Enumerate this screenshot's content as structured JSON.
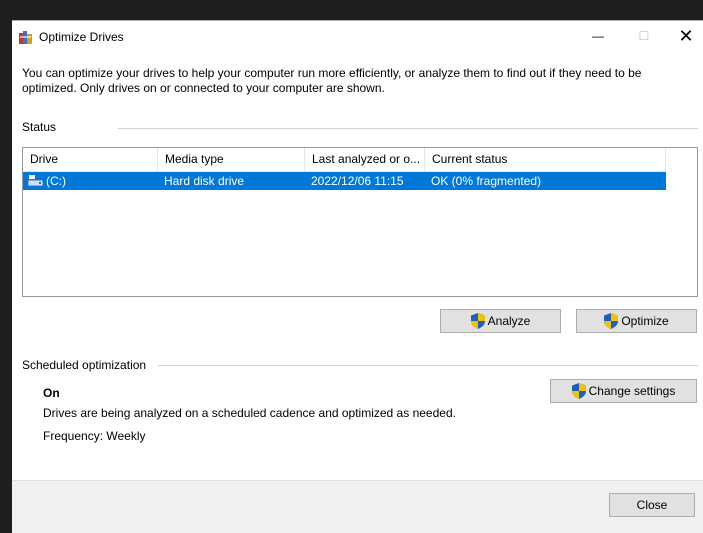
{
  "window": {
    "title": "Optimize Drives",
    "minimize_glyph": "—",
    "maximize_glyph": "☐",
    "close_glyph": "✕"
  },
  "intro_text": "You can optimize your drives to help your computer run more efficiently, or analyze them to find out if they need to be optimized. Only drives on or connected to your computer are shown.",
  "status": {
    "label": "Status",
    "columns": [
      "Drive",
      "Media type",
      "Last analyzed or o...",
      "Current status"
    ],
    "rows": [
      {
        "drive": "(C:)",
        "media_type": "Hard disk drive",
        "last_analyzed": "2022/12/06 11:15",
        "current_status": "OK (0% fragmented)",
        "selected": true
      }
    ],
    "analyze_label": "Analyze",
    "optimize_label": "Optimize"
  },
  "scheduled": {
    "label": "Scheduled optimization",
    "state": "On",
    "description": "Drives are being analyzed on a scheduled cadence and optimized as needed.",
    "frequency": "Frequency: Weekly",
    "change_settings_label": "Change settings"
  },
  "footer": {
    "close_label": "Close"
  },
  "colors": {
    "selection": "#0078d7",
    "button": "#e1e1e1",
    "shield_blue": "#1f5fbf",
    "shield_yellow": "#f2c200"
  },
  "icons": [
    "defrag-app-icon",
    "hard-drive-icon",
    "uac-shield-icon"
  ]
}
